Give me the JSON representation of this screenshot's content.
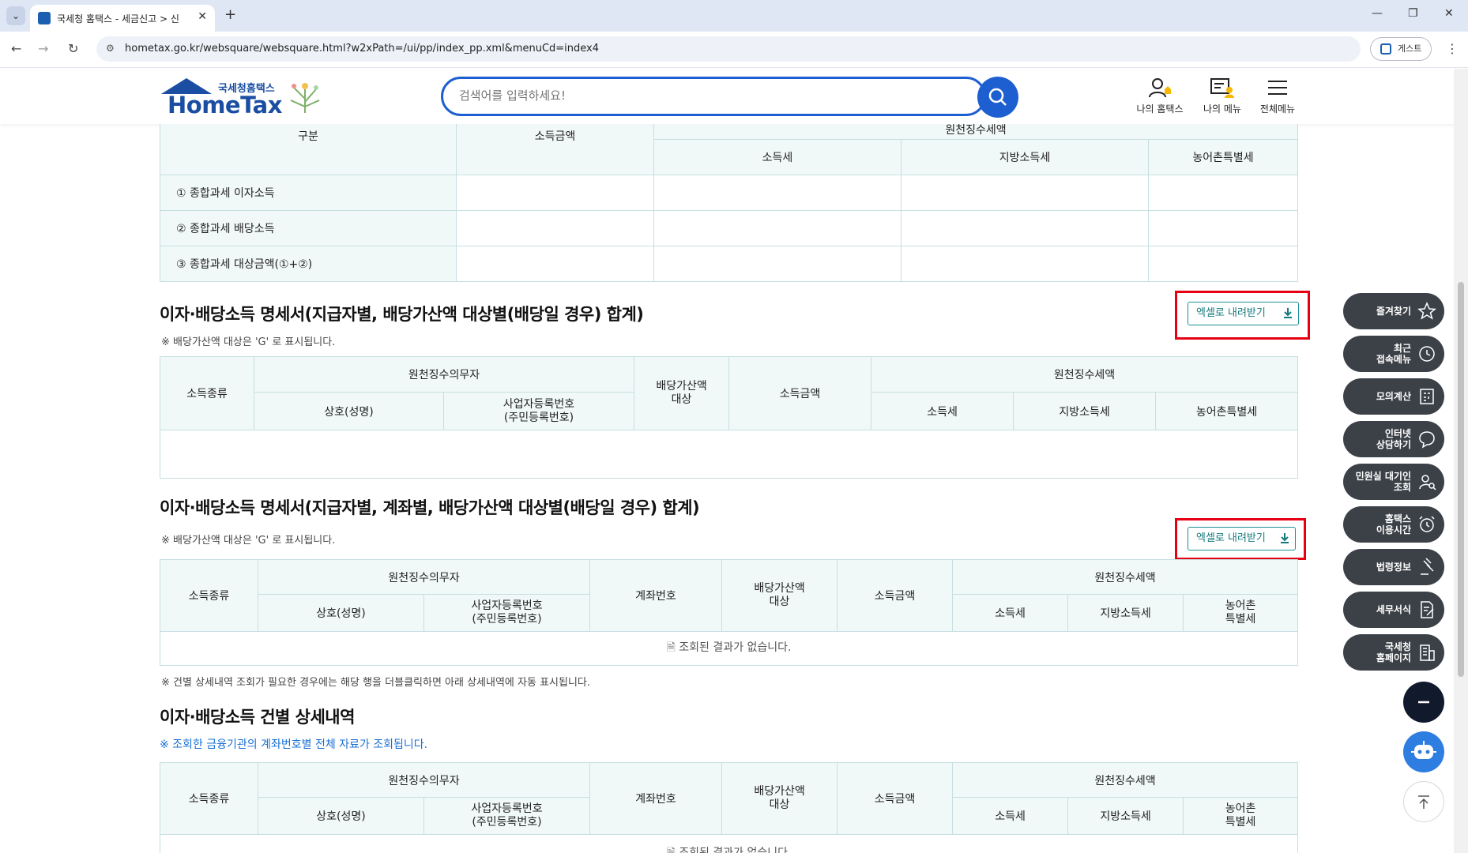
{
  "browser": {
    "tab_title": "국세청 홈택스 - 세금신고 > 신",
    "url": "hometax.go.kr/websquare/websquare.html?w2xPath=/ui/pp/index_pp.xml&menuCd=index4",
    "profile_label": "게스트"
  },
  "header": {
    "logo_sub": "국세청홈택스",
    "logo_main": "HomeTax",
    "search_placeholder": "검색어를 입력하세요!",
    "menus": [
      "나의 홈택스",
      "나의 메뉴",
      "전체메뉴"
    ]
  },
  "table0": {
    "col_category": "구분",
    "col_income": "소득금액",
    "col_group_partial": "원천징수세액",
    "col_tax1": "소득세",
    "col_tax2": "지방소득세",
    "col_tax3": "농어촌특별세",
    "rows": [
      "① 종합과세 이자소득",
      "② 종합과세 배당소득",
      "③ 종합과세 대상금액(①+②)"
    ]
  },
  "section1": {
    "title": "이자·배당소득 명세서(지급자별, 배당가산액 대상별(배당일 경우) 합계)",
    "note": "※ 배당가산액 대상은 'G' 로 표시됩니다.",
    "excel_btn": "엑셀로 내려받기",
    "h_type": "소득종류",
    "h_payer": "원천징수의무자",
    "h_name": "상호(성명)",
    "h_bizno": "사업자등록번호\n(주민등록번호)",
    "h_divadd": "배당가산액\n대상",
    "h_income": "소득금액",
    "h_withheld": "원천징수세액",
    "h_tax1": "소득세",
    "h_tax2": "지방소득세",
    "h_tax3": "농어촌특별세"
  },
  "section2": {
    "title": "이자·배당소득 명세서(지급자별, 계좌별, 배당가산액 대상별(배당일 경우) 합계)",
    "note": "※ 배당가산액 대상은 'G' 로 표시됩니다.",
    "excel_btn": "엑셀로 내려받기",
    "h_type": "소득종류",
    "h_payer": "원천징수의무자",
    "h_name": "상호(성명)",
    "h_bizno": "사업자등록번호\n(주민등록번호)",
    "h_account": "계좌번호",
    "h_divadd": "배당가산액\n대상",
    "h_income": "소득금액",
    "h_withheld": "원천징수세액",
    "h_tax1": "소득세",
    "h_tax2": "지방소득세",
    "h_tax3": "농어촌\n특별세",
    "empty": "조회된 결과가 없습니다.",
    "footnote": "※ 건별 상세내역 조회가 필요한 경우에는 해당 행을 더블클릭하면 아래 상세내역에 자동 표시됩니다."
  },
  "section3": {
    "title": "이자·배당소득 건별 상세내역",
    "note": "※ 조회한 금융기관의 계좌번호별 전체 자료가 조회됩니다.",
    "h_type": "소득종류",
    "h_payer": "원천징수의무자",
    "h_name": "상호(성명)",
    "h_bizno": "사업자등록번호\n(주민등록번호)",
    "h_account": "계좌번호",
    "h_divadd": "배당가산액\n대상",
    "h_income": "소득금액",
    "h_withheld": "원천징수세액",
    "h_tax1": "소득세",
    "h_tax2": "지방소득세",
    "h_tax3": "농어촌\n특별세",
    "empty": "조회된 결과가 없습니다."
  },
  "quickmenu": [
    {
      "label": "즐겨찾기",
      "icon": "star-icon"
    },
    {
      "label": "최근\n접속메뉴",
      "icon": "clock-icon"
    },
    {
      "label": "모의계산",
      "icon": "calculator-icon"
    },
    {
      "label": "인터넷\n상담하기",
      "icon": "chat-icon"
    },
    {
      "label": "민원실 대기인\n조회",
      "icon": "person-search-icon"
    },
    {
      "label": "홈택스\n이용시간",
      "icon": "alarm-icon"
    },
    {
      "label": "법령정보",
      "icon": "gavel-icon"
    },
    {
      "label": "세무서식",
      "icon": "document-edit-icon"
    },
    {
      "label": "국세청\n홈페이지",
      "icon": "building-icon"
    }
  ],
  "colors": {
    "brand": "#1b4ea2",
    "search": "#1d5fd0",
    "table_border": "#c6dfe0",
    "highlight": "#e60012",
    "excel": "#14797d"
  }
}
